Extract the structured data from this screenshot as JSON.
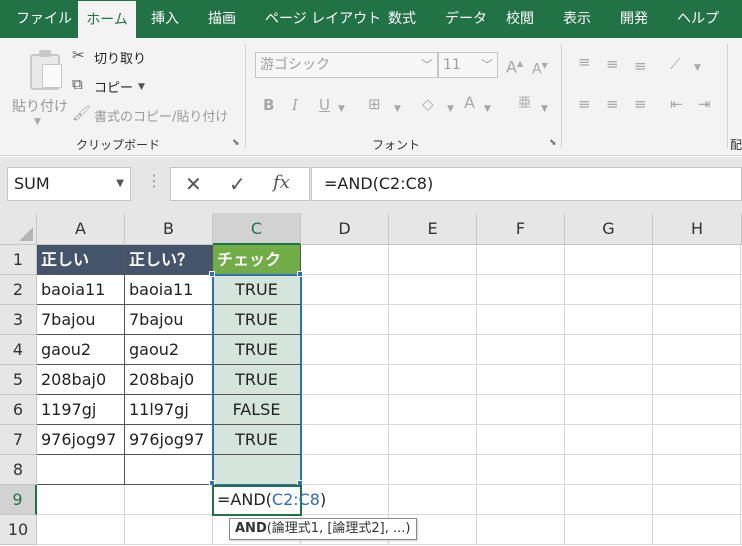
{
  "ribbon_tabs": [
    "ファイル",
    "ホーム",
    "挿入",
    "描画",
    "ページ レイアウト",
    "数式",
    "データ",
    "校閲",
    "表示",
    "開発",
    "ヘルプ"
  ],
  "active_tab": "ホーム",
  "clipboard": {
    "paste": "貼り付け",
    "cut": "切り取り",
    "copy": "コピー",
    "format_painter": "書式のコピー/貼り付け",
    "label": "クリップボード"
  },
  "font": {
    "name": "游ゴシック",
    "size": "11",
    "bold": "B",
    "italic": "I",
    "underline": "U",
    "grow": "A",
    "shrink": "A",
    "color": "A",
    "phonetic": "亜",
    "label": "フォント"
  },
  "alignment_label_partial": "配",
  "name_box": "SUM",
  "formula_bar": {
    "cancel": "✕",
    "enter": "✓",
    "fx": "fx",
    "content": "=AND(C2:C8)"
  },
  "columns": [
    "A",
    "B",
    "C",
    "D",
    "E",
    "F",
    "G",
    "H"
  ],
  "rows": [
    "1",
    "2",
    "3",
    "4",
    "5",
    "6",
    "7",
    "8",
    "9",
    "10"
  ],
  "table": {
    "headers": [
      "正しい",
      "正しい？",
      "チェック"
    ],
    "rows": [
      [
        "baoia11",
        "baoia11",
        "TRUE"
      ],
      [
        "7bajou",
        "7bajou",
        "TRUE"
      ],
      [
        "gaou2",
        "gaou2",
        "TRUE"
      ],
      [
        "208baj0",
        "208baj0",
        "TRUE"
      ],
      [
        "1197gj",
        "11l97gj",
        "FALSE"
      ],
      [
        "976jog97",
        "976jog97",
        "TRUE"
      ]
    ]
  },
  "editing_cell": {
    "prefix": "=AND(",
    "ref": "C2:C8",
    "suffix": ")"
  },
  "tooltip": {
    "func": "AND",
    "args": "(論理式1, [論理式2], ...)"
  },
  "colors": {
    "ribbon_green": "#217346",
    "header_dark": "#44546a",
    "header_green": "#70ad47",
    "check_fill": "#d6e5d9",
    "reference_blue": "#2f6dbd"
  }
}
